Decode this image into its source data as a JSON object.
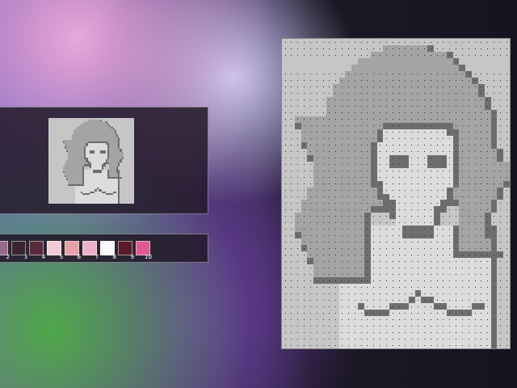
{
  "palette": [
    {
      "number": "2",
      "color": "#9a6a8c"
    },
    {
      "number": "3",
      "color": "#3a2430"
    },
    {
      "number": "4",
      "color": "#5a2a3a"
    },
    {
      "number": "5",
      "color": "#f2cad2"
    },
    {
      "number": "6",
      "color": "#e6a0a8"
    },
    {
      "number": "7",
      "color": "#eeb0c8"
    },
    {
      "number": "8",
      "color": "#f8f8f8"
    },
    {
      "number": "9",
      "color": "#5a1a28"
    },
    {
      "number": "10",
      "color": "#e05890"
    }
  ]
}
